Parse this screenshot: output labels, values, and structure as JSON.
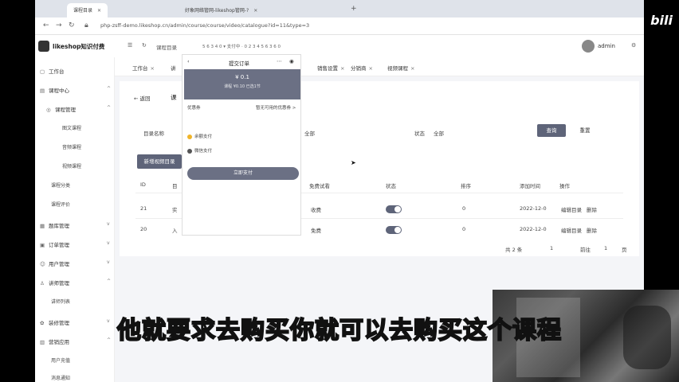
{
  "browser": {
    "tabs": [
      {
        "label": "课程目录",
        "active": true
      },
      {
        "label": "好象网络管网-likeshop管网-?",
        "active": false
      }
    ],
    "url": "php-zsff-demo.likeshop.cn/admin/course/course/video/catalogue?id=11&type=3"
  },
  "topnav": {
    "logo": "likeshop知识付费",
    "breadcrumb": "课程目录",
    "breadcrumb_extra": "5 6 3 4 0 ▾ 支付中 · 0 2 3 4 5 6 3 6 0",
    "admin": "admin"
  },
  "sidebar": {
    "items": [
      {
        "label": "工作台",
        "icon": "dashboard-icon",
        "caret": ""
      },
      {
        "label": "课程中心",
        "icon": "course-icon",
        "caret": "^"
      },
      {
        "label": "课程管理",
        "icon": "circle-icon",
        "caret": "^"
      },
      {
        "label": "图文课程",
        "icon": "",
        "caret": ""
      },
      {
        "label": "音频课程",
        "icon": "",
        "caret": ""
      },
      {
        "label": "视频课程",
        "icon": "",
        "caret": ""
      },
      {
        "label": "课程分类",
        "icon": "",
        "caret": ""
      },
      {
        "label": "课程评价",
        "icon": "",
        "caret": ""
      },
      {
        "label": "题库管理",
        "icon": "grid-icon",
        "caret": "v"
      },
      {
        "label": "订单管理",
        "icon": "order-icon",
        "caret": "v"
      },
      {
        "label": "用户管理",
        "icon": "user-icon",
        "caret": "v"
      },
      {
        "label": "讲师管理",
        "icon": "teacher-icon",
        "caret": "^"
      },
      {
        "label": "讲师列表",
        "icon": "",
        "caret": ""
      },
      {
        "label": "装修管理",
        "icon": "decor-icon",
        "caret": "v"
      },
      {
        "label": "营销应用",
        "icon": "app-icon",
        "caret": "^"
      },
      {
        "label": "用户充值",
        "icon": "",
        "caret": ""
      },
      {
        "label": "消息通知",
        "icon": "",
        "caret": ""
      }
    ]
  },
  "page_tabs": [
    {
      "label": "工作台"
    },
    {
      "label": "讲"
    },
    {
      "label": "销售设置"
    },
    {
      "label": "分销商"
    },
    {
      "label": "视频课程"
    }
  ],
  "content": {
    "back": "返回",
    "title": "课",
    "filters": {
      "name_label": "目录名称",
      "name_value": "",
      "type_value": "全部",
      "status_label": "状态",
      "status_value": "全部"
    },
    "search_btn": "查询",
    "reset_btn": "重置",
    "add_btn": "新增视频目录",
    "table": {
      "headers": [
        "ID",
        "目",
        "免费试看",
        "状态",
        "排序",
        "添加时间",
        "操作"
      ],
      "rows": [
        {
          "id": "21",
          "name": "实",
          "free": "收费",
          "sort": "0",
          "time": "2022-12-0",
          "edit": "编辑目录",
          "delete": "删除"
        },
        {
          "id": "20",
          "name": "入",
          "free": "免费",
          "sort": "0",
          "time": "2022-12-0",
          "edit": "编辑目录",
          "delete": "删除"
        }
      ]
    },
    "pager": {
      "total": "共 2 条",
      "page": "1",
      "goto": "前往",
      "goto_page": "1",
      "unit": "页"
    }
  },
  "modal": {
    "title": "提交订单",
    "amount": "¥ 0.1",
    "amount_sub": "课程 ¥0.10 已选1节",
    "coupon_label": "优惠券",
    "coupon_value": "暂无可用的优惠券 >",
    "pay_options": [
      {
        "label": "余额支付",
        "color": "#f0b429"
      },
      {
        "label": "微信支付",
        "color": "#555555"
      }
    ],
    "pay_btn": "立即支付"
  },
  "subtitle": "他就要求去购买你就可以去购买这个课程",
  "watermark": "bili"
}
